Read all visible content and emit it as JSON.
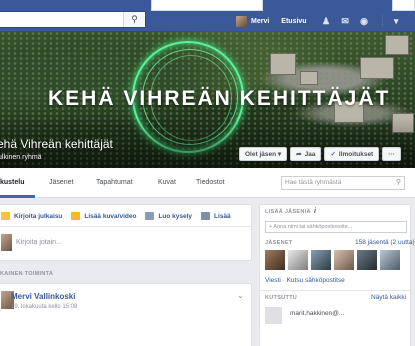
{
  "topbar": {
    "search_icon": "search-icon",
    "user_name": "Mervi",
    "home_label": "Etusivu",
    "icons": [
      "friends-icon",
      "messages-icon",
      "globe-icon",
      "account-menu-icon"
    ]
  },
  "cover": {
    "title": "KEHÄ VIHREÄN KEHITTÄJÄT",
    "group_name": "ehä Vihreän kehittäjät",
    "group_type": "ulkinen ryhmä",
    "buttons": {
      "member": "Olet jäsen ▾",
      "share": "Jaa",
      "notifications": "Ilmoitukset",
      "more": "···"
    }
  },
  "tabs": {
    "items": [
      "kustelu",
      "Jäsenet",
      "Tapahtumat",
      "Kuvat",
      "Tiedostot"
    ],
    "search_placeholder": "Hae tästä ryhmästä"
  },
  "composer": {
    "write_post": "Kirjoita julkaisu",
    "add_photo": "Lisää kuva/video",
    "poll": "Luo kysely",
    "more": "Lisää",
    "input_placeholder": "Kirjoita jotain..."
  },
  "feed": {
    "recent_label": "KAINEN TOIMINTA",
    "post": {
      "author": "Mervi Vallinkoski",
      "time": "19. lokakuuta kello 15:08"
    }
  },
  "sidebar": {
    "add_members_heading": "LISÄÄ JÄSENIÄ",
    "add_members_placeholder": "+ Anna nimi tai sähköpostiosoite...",
    "members_heading": "JÄSENET",
    "members_count": "158 jäsentä (2 uutta)",
    "message_link": "Viesti",
    "invite_email_link": "Kutsu sähköpostitse",
    "invited_heading": "KUTSUTTU",
    "show_all": "Näytä kaikki",
    "invited_name": "marit.hakkinen@..."
  },
  "colors": {
    "facebook_blue": "#3b5998",
    "link_blue": "#365899",
    "ring_green": "#5ff09a"
  }
}
